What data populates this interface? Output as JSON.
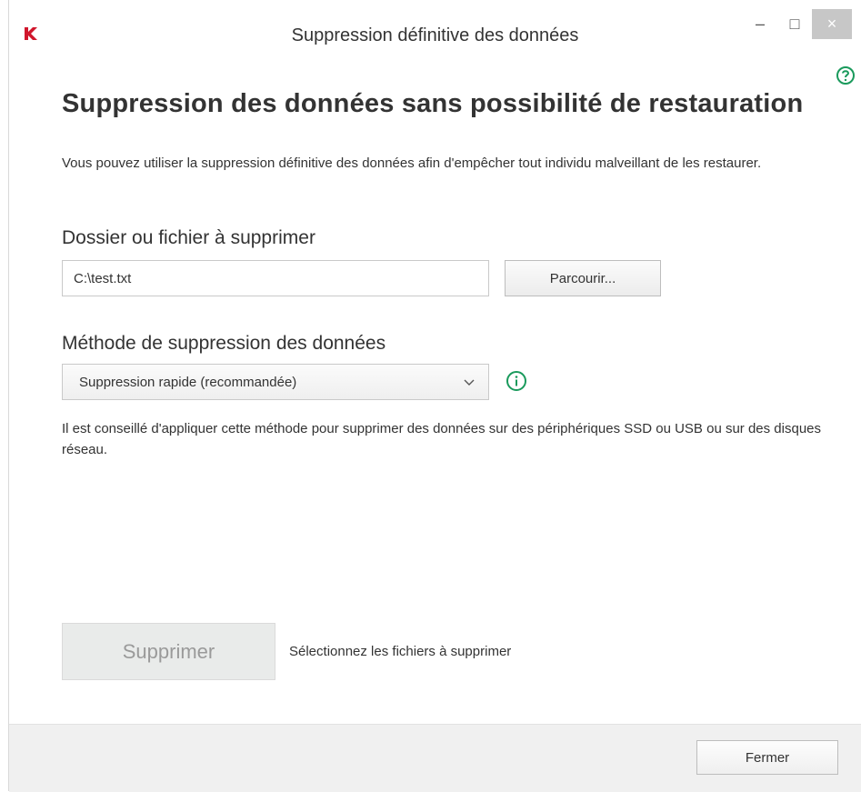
{
  "window": {
    "title": "Suppression définitive des données",
    "controls": {
      "minimize": "–",
      "maximize": "□",
      "close": "×"
    }
  },
  "main": {
    "heading": "Suppression des données sans possibilité de restauration",
    "description": "Vous pouvez utiliser la suppression définitive des données afin d'empêcher tout individu malveillant de les restaurer.",
    "target_label": "Dossier ou fichier à supprimer",
    "target_value": "C:\\test.txt",
    "browse_label": "Parcourir...",
    "method_label": "Méthode de suppression des données",
    "method_selected": "Suppression rapide (recommandée)",
    "method_hint": "Il est conseillé d'appliquer cette méthode pour supprimer des données sur des périphériques SSD ou USB ou sur des disques réseau.",
    "delete_label": "Supprimer",
    "delete_hint": "Sélectionnez les fichiers à supprimer"
  },
  "footer": {
    "close_label": "Fermer"
  },
  "icons": {
    "app": "kaspersky-k-icon",
    "help": "help-circle-icon",
    "info": "info-circle-icon",
    "dropdown": "chevron-down-icon"
  },
  "colors": {
    "accent_green": "#1a9a5c",
    "logo_red": "#d0162c"
  }
}
